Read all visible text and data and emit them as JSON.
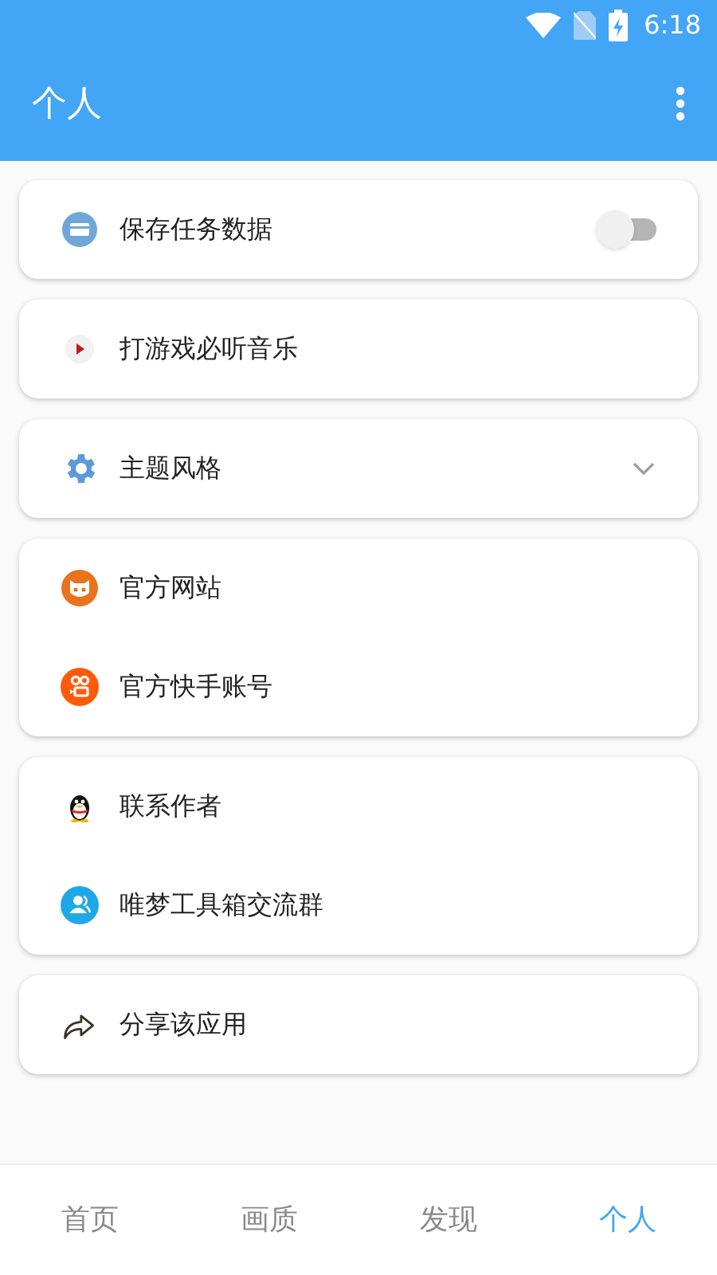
{
  "status_bar": {
    "time": "6:18"
  },
  "app_bar": {
    "title": "个人"
  },
  "groups": [
    {
      "items": [
        {
          "kind": "toggle",
          "label": "保存任务数据",
          "on": false
        }
      ]
    },
    {
      "items": [
        {
          "kind": "plain",
          "label": "打游戏必听音乐"
        }
      ]
    },
    {
      "items": [
        {
          "kind": "dropdown",
          "label": "主题风格",
          "expanded": false
        }
      ]
    },
    {
      "items": [
        {
          "kind": "plain",
          "label": "官方网站"
        },
        {
          "kind": "plain",
          "label": "官方快手账号"
        }
      ]
    },
    {
      "items": [
        {
          "kind": "plain",
          "label": "联系作者"
        },
        {
          "kind": "plain",
          "label": "唯梦工具箱交流群"
        }
      ]
    },
    {
      "items": [
        {
          "kind": "plain",
          "label": "分享该应用"
        }
      ]
    }
  ],
  "bottom_nav": [
    {
      "label": "首页",
      "selected": false
    },
    {
      "label": "画质",
      "selected": false
    },
    {
      "label": "发现",
      "selected": false
    },
    {
      "label": "个人",
      "selected": true
    }
  ]
}
